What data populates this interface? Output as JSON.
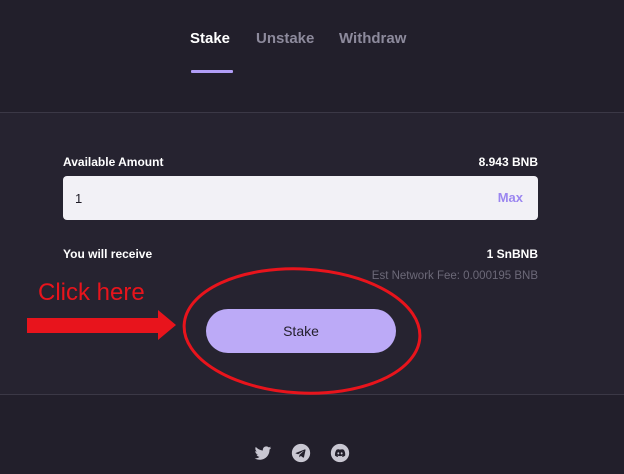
{
  "tabs": [
    {
      "label": "Stake",
      "active": true
    },
    {
      "label": "Unstake",
      "active": false
    },
    {
      "label": "Withdraw",
      "active": false
    }
  ],
  "form": {
    "available_label": "Available Amount",
    "available_value": "8.943 BNB",
    "amount_value": "1",
    "max_label": "Max",
    "receive_label": "You will receive",
    "receive_value": "1 SnBNB",
    "fee_text": "Est Network Fee: 0.000195 BNB",
    "stake_button_label": "Stake"
  },
  "annotation": {
    "text": "Click here",
    "color": "#e8141c"
  },
  "footer": {
    "icons": [
      "twitter-icon",
      "telegram-icon",
      "discord-icon"
    ]
  },
  "colors": {
    "background": "#262330",
    "accent": "#b19ef7",
    "button": "#bcaaf7"
  }
}
